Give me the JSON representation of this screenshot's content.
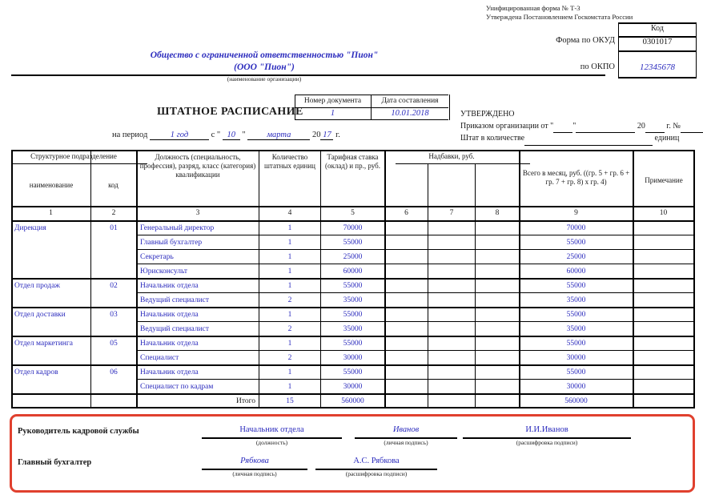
{
  "form_header": {
    "line1": "Унифицированная форма № Т-3",
    "line2": "Утверждена Постановлением Госкомстата России",
    "code_title": "Код",
    "okud_label": "Форма по ОКУД",
    "okud_value": "0301017",
    "okpo_label": "по ОКПО",
    "okpo_value": "12345678"
  },
  "organization": {
    "name_full": "Общество с ограниченной ответственностью \"Пион\"",
    "name_short": "(ООО \"Пион\")",
    "caption": "(наименование организации)"
  },
  "title": "ШТАТНОЕ РАСПИСАНИЕ",
  "doc_box": {
    "number_header": "Номер документа",
    "date_header": "Дата составления",
    "number_value": "1",
    "date_value": "10.01.2018"
  },
  "period": {
    "label": "на период",
    "term_value": "1 год",
    "from_word": "с \"",
    "day_value": "10",
    "quote_close": "\"",
    "month_value": "марта",
    "year_prefix": "20",
    "year_value": "17",
    "year_suffix": "г."
  },
  "approved": {
    "title": "УТВЕРЖДЕНО",
    "order_line_prefix": "Приказом организации от \"",
    "order_quote": "\"",
    "order_year": "20",
    "order_year_suffix": "г. №",
    "staff_line": "Штат в количестве",
    "units_word": "единиц"
  },
  "table": {
    "group_header_structural": "Структурное подразделение",
    "group_header_bonus": "Надбавки, руб.",
    "headers": [
      "наименование",
      "код",
      "Должность (специальность, профессия), разряд, класс (категория) квалификации",
      "Количество штатных единиц",
      "Тарифная ставка (оклад) и пр., руб.",
      "",
      "",
      "",
      "Всего в месяц, руб. ((гр. 5 + гр. 6 + гр. 7 + гр. 8) х гр. 4)",
      "Примечание"
    ],
    "column_numbers": [
      "1",
      "2",
      "3",
      "4",
      "5",
      "6",
      "7",
      "8",
      "9",
      "10"
    ],
    "departments": [
      {
        "name": "Дирекция",
        "code": "01",
        "positions": [
          {
            "title": "Генеральный директор",
            "units": "1",
            "rate": "70000",
            "bonus6": "",
            "bonus7": "",
            "bonus8": "",
            "total": "70000",
            "note": ""
          },
          {
            "title": "Главный бухгалтер",
            "units": "1",
            "rate": "55000",
            "bonus6": "",
            "bonus7": "",
            "bonus8": "",
            "total": "55000",
            "note": ""
          },
          {
            "title": "Секретарь",
            "units": "1",
            "rate": "25000",
            "bonus6": "",
            "bonus7": "",
            "bonus8": "",
            "total": "25000",
            "note": ""
          },
          {
            "title": "Юрисконсульт",
            "units": "1",
            "rate": "60000",
            "bonus6": "",
            "bonus7": "",
            "bonus8": "",
            "total": "60000",
            "note": ""
          }
        ]
      },
      {
        "name": "Отдел продаж",
        "code": "02",
        "positions": [
          {
            "title": "Начальник отдела",
            "units": "1",
            "rate": "55000",
            "bonus6": "",
            "bonus7": "",
            "bonus8": "",
            "total": "55000",
            "note": ""
          },
          {
            "title": "Ведущий специалист",
            "units": "2",
            "rate": "35000",
            "bonus6": "",
            "bonus7": "",
            "bonus8": "",
            "total": "35000",
            "note": ""
          }
        ]
      },
      {
        "name": "Отдел доставки",
        "code": "03",
        "positions": [
          {
            "title": "Начальник отдела",
            "units": "1",
            "rate": "55000",
            "bonus6": "",
            "bonus7": "",
            "bonus8": "",
            "total": "55000",
            "note": ""
          },
          {
            "title": "Ведущий специалист",
            "units": "2",
            "rate": "35000",
            "bonus6": "",
            "bonus7": "",
            "bonus8": "",
            "total": "35000",
            "note": ""
          }
        ]
      },
      {
        "name": "Отдел маркетинга",
        "code": "05",
        "positions": [
          {
            "title": "Начальник отдела",
            "units": "1",
            "rate": "55000",
            "bonus6": "",
            "bonus7": "",
            "bonus8": "",
            "total": "55000",
            "note": ""
          },
          {
            "title": "Специалист",
            "units": "2",
            "rate": "30000",
            "bonus6": "",
            "bonus7": "",
            "bonus8": "",
            "total": "30000",
            "note": ""
          }
        ]
      },
      {
        "name": "Отдел кадров",
        "code": "06",
        "positions": [
          {
            "title": "Начальник отдела",
            "units": "1",
            "rate": "55000",
            "bonus6": "",
            "bonus7": "",
            "bonus8": "",
            "total": "55000",
            "note": ""
          },
          {
            "title": "Специалист по кадрам",
            "units": "1",
            "rate": "30000",
            "bonus6": "",
            "bonus7": "",
            "bonus8": "",
            "total": "30000",
            "note": ""
          }
        ]
      }
    ],
    "total_row": {
      "label": "Итого",
      "units": "15",
      "rate": "560000",
      "bonus6": "",
      "bonus7": "",
      "bonus8": "",
      "total": "560000",
      "note": ""
    }
  },
  "signatures": {
    "accent_color": "#e0402e",
    "row1": {
      "role": "Руководитель кадровой службы",
      "position_value": "Начальник отдела",
      "position_caption": "(должность)",
      "signature_value": "Иванов",
      "signature_caption": "(личная подпись)",
      "name_value": "И.И.Иванов",
      "name_caption": "(расшифровка подписи)"
    },
    "row2": {
      "role": "Главный бухгалтер",
      "signature_value": "Рябкова",
      "signature_caption": "(личная подпись)",
      "name_value": "А.С. Рябкова",
      "name_caption": "(расшифровка подписи)"
    }
  }
}
